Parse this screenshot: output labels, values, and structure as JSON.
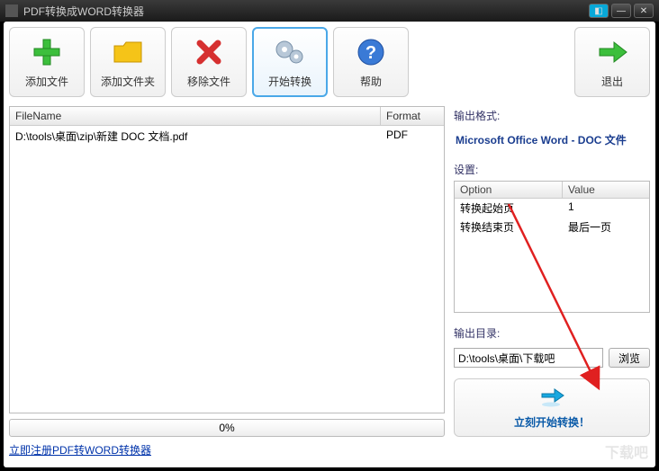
{
  "title": "PDF转换成WORD转换器",
  "toolbar": {
    "add_file": "添加文件",
    "add_folder": "添加文件夹",
    "remove": "移除文件",
    "start": "开始转换",
    "help": "帮助",
    "exit": "退出"
  },
  "table": {
    "header_filename": "FileName",
    "header_format": "Format",
    "rows": [
      {
        "filename": "D:\\tools\\桌面\\zip\\新建 DOC 文档.pdf",
        "format": "PDF"
      }
    ]
  },
  "progress_text": "0%",
  "output_format": {
    "label": "输出格式:",
    "value": "Microsoft Office Word - DOC 文件"
  },
  "settings": {
    "label": "设置:",
    "header_option": "Option",
    "header_value": "Value",
    "rows": [
      {
        "option": "转换起始页",
        "value": "1"
      },
      {
        "option": "转换结束页",
        "value": "最后一页"
      }
    ]
  },
  "output_dir": {
    "label": "输出目录:",
    "value": "D:\\tools\\桌面\\下载吧",
    "browse": "浏览"
  },
  "start_now": "立刻开始转换！",
  "footer_link": "立即注册PDF转WORD转换器",
  "watermark": "下载吧"
}
